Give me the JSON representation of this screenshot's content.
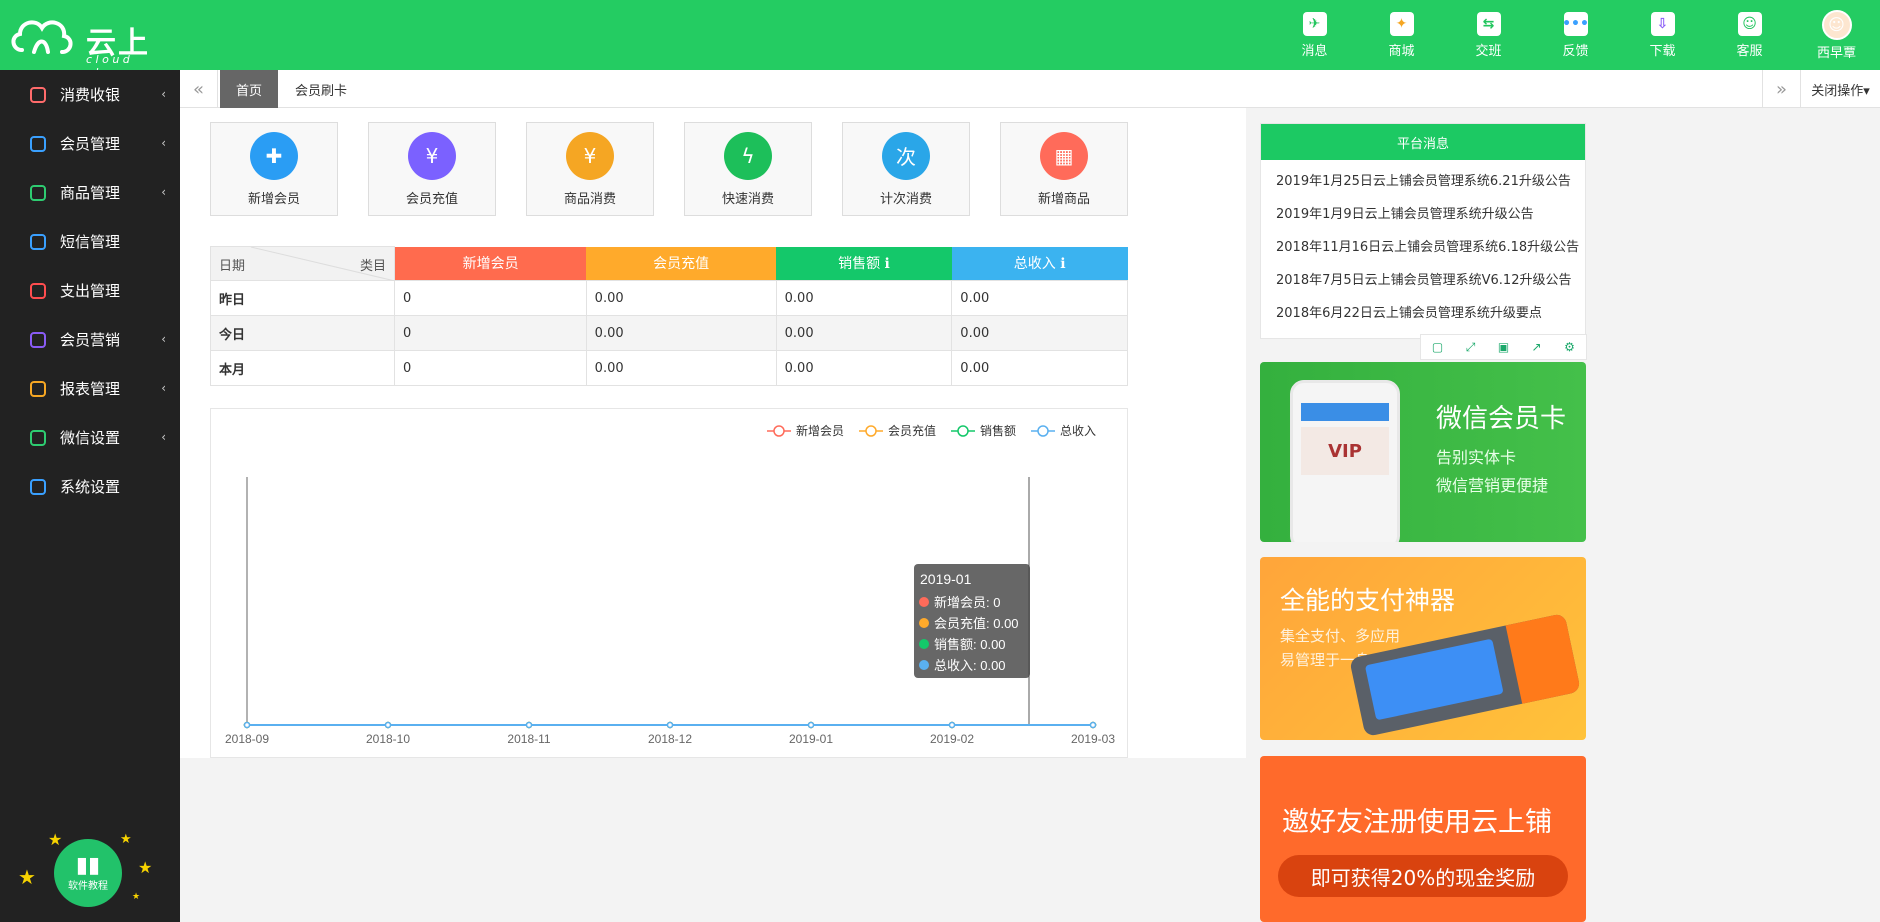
{
  "app": {
    "title": "云上铺",
    "subtitle": "cloud shop"
  },
  "topnav": [
    {
      "label": "消息",
      "icon": "paper-plane-icon",
      "glyph": "✈",
      "color": "#22c55e"
    },
    {
      "label": "商城",
      "icon": "store-icon",
      "glyph": "✦",
      "color": "#f5a623"
    },
    {
      "label": "交班",
      "icon": "swap-icon",
      "glyph": "⇆",
      "color": "#22c55e"
    },
    {
      "label": "反馈",
      "icon": "chat-icon",
      "glyph": "•••",
      "color": "#3aa0ff"
    },
    {
      "label": "下载",
      "icon": "download-icon",
      "glyph": "⇩",
      "color": "#8a5cf6"
    },
    {
      "label": "客服",
      "icon": "support-icon",
      "glyph": "☺",
      "color": "#22c55e"
    }
  ],
  "user": {
    "name": "西早覃"
  },
  "sidebar": {
    "items": [
      {
        "label": "消费收银",
        "icon": "cashier-icon",
        "color": "#ff6b6b",
        "chevron": true
      },
      {
        "label": "会员管理",
        "icon": "members-icon",
        "color": "#3aa0ff",
        "chevron": true
      },
      {
        "label": "商品管理",
        "icon": "goods-icon",
        "color": "#2ecc71",
        "chevron": true
      },
      {
        "label": "短信管理",
        "icon": "sms-icon",
        "color": "#3aa0ff",
        "chevron": false
      },
      {
        "label": "支出管理",
        "icon": "expense-icon",
        "color": "#ff4d4f",
        "chevron": false
      },
      {
        "label": "会员营销",
        "icon": "gift-icon",
        "color": "#8a5cf6",
        "chevron": true
      },
      {
        "label": "报表管理",
        "icon": "report-icon",
        "color": "#f5a623",
        "chevron": true
      },
      {
        "label": "微信设置",
        "icon": "wechat-icon",
        "color": "#2ecc71",
        "chevron": true
      },
      {
        "label": "系统设置",
        "icon": "settings-icon",
        "color": "#3aa0ff",
        "chevron": false
      }
    ],
    "tutorial": "软件教程"
  },
  "tabs": {
    "home": "首页",
    "member_card": "会员刷卡",
    "close_ops": "关闭操作▾"
  },
  "quick_actions": [
    {
      "label": "新增会员",
      "glyph": "✚",
      "color": "#2a9df4"
    },
    {
      "label": "会员充值",
      "glyph": "¥",
      "color": "#7b61ff"
    },
    {
      "label": "商品消费",
      "glyph": "¥",
      "color": "#f5a623"
    },
    {
      "label": "快速消费",
      "glyph": "ϟ",
      "color": "#1dbf5a"
    },
    {
      "label": "计次消费",
      "glyph": "次",
      "color": "#2aa6e8"
    },
    {
      "label": "新增商品",
      "glyph": "▦",
      "color": "#ff6b5a"
    }
  ],
  "stats": {
    "header_date": "日期",
    "header_category": "类目",
    "columns": [
      {
        "label": "新增会员",
        "color": "#ff6b4e"
      },
      {
        "label": "会员充值",
        "color": "#ffaa2b"
      },
      {
        "label": "销售额 ℹ",
        "color": "#14c86a"
      },
      {
        "label": "总收入 ℹ",
        "color": "#3bb3f0"
      }
    ],
    "rows": [
      {
        "label": "昨日",
        "values": [
          "0",
          "0.00",
          "0.00",
          "0.00"
        ]
      },
      {
        "label": "今日",
        "values": [
          "0",
          "0.00",
          "0.00",
          "0.00"
        ]
      },
      {
        "label": "本月",
        "values": [
          "0",
          "0.00",
          "0.00",
          "0.00"
        ]
      }
    ]
  },
  "chart_data": {
    "type": "line",
    "categories": [
      "2018-09",
      "2018-10",
      "2018-11",
      "2018-12",
      "2019-01",
      "2019-02",
      "2019-03"
    ],
    "series": [
      {
        "name": "新增会员",
        "color": "#ff6b5a",
        "values": [
          0,
          0,
          0,
          0,
          0,
          0,
          0
        ]
      },
      {
        "name": "会员充值",
        "color": "#ffaa2b",
        "values": [
          0,
          0,
          0,
          0,
          0,
          0,
          0
        ]
      },
      {
        "name": "销售额",
        "color": "#14c86a",
        "values": [
          0,
          0,
          0,
          0,
          0,
          0,
          0
        ]
      },
      {
        "name": "总收入",
        "color": "#5ab0f0",
        "values": [
          0,
          0,
          0,
          0,
          0,
          0,
          0
        ]
      }
    ],
    "legend_position": "top-right",
    "tooltip": {
      "title": "2019-01",
      "lines": [
        "新增会员: 0",
        "会员充值: 0.00",
        "销售额: 0.00",
        "总收入: 0.00"
      ]
    }
  },
  "notice": {
    "title": "平台消息",
    "items": [
      "2019年1月25日云上铺会员管理系统6.21升级公告",
      "2019年1月9日云上铺会员管理系统升级公告",
      "2018年11月16日云上铺会员管理系统6.18升级公告",
      "2018年7月5日云上铺会员管理系统V6.12升级公告",
      "2018年6月22日云上铺会员管理系统升级要点"
    ],
    "tools": [
      "restore-icon",
      "fullscreen-icon",
      "save-icon",
      "export-icon",
      "settings-icon"
    ]
  },
  "banners": {
    "wechat": {
      "title": "微信会员卡",
      "line1": "告别实体卡",
      "line2": "微信营销更便捷"
    },
    "pay": {
      "title": "全能的支付神器",
      "line1": "集全支付、多应用",
      "line2": "易管理于一身"
    },
    "invite": {
      "title": "邀好友注册使用云上铺",
      "button": "即可获得20%的现金奖励"
    }
  }
}
